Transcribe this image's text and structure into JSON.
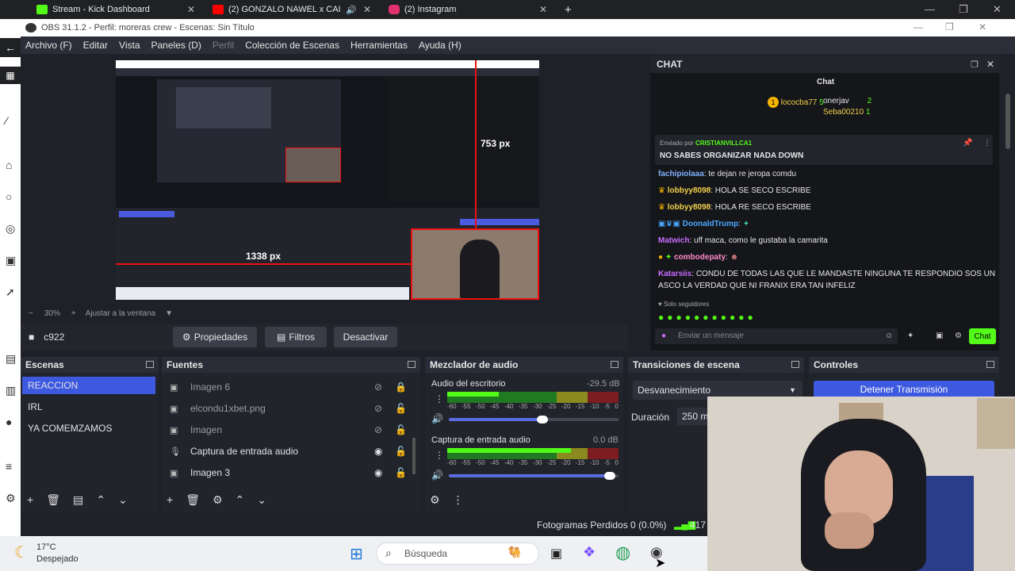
{
  "browser": {
    "tabs": [
      {
        "label": "Stream - Kick Dashboard",
        "color": "#53fc18"
      },
      {
        "label": "(2) GONZALO NAWEL x CAI",
        "color": "#ff0000"
      },
      {
        "label": "(2) Instagram",
        "color": "#e1306c"
      }
    ],
    "new_tab": "+"
  },
  "obs": {
    "title": "OBS 31.1.2 - Perfil: moreras crew - Escenas: Sin Título",
    "menu": [
      "Archivo (F)",
      "Editar",
      "Vista",
      "Paneles (D)",
      "Perfil",
      "Colección de Escenas",
      "Herramientas",
      "Ayuda (H)"
    ],
    "zoom": "30%",
    "zoom_fit": "Ajustar a la ventana",
    "source_name": "c922",
    "buttons": {
      "properties": "Propiedades",
      "filters": "Filtros",
      "deactivate": "Desactivar"
    },
    "preview": {
      "w_label": "1338 px",
      "h_label": "753 px"
    },
    "docks": {
      "scenes": "Escenas",
      "sources": "Fuentes",
      "mixer": "Mezclador de audio",
      "transitions": "Transiciones de escena",
      "controls": "Controles"
    },
    "scenes": [
      "REACCION",
      "IRL",
      "YA COMEMZAMOS"
    ],
    "sources": [
      {
        "name": "Imagen 6",
        "visible": false,
        "locked": true
      },
      {
        "name": "elcondu1xbet.png",
        "visible": false,
        "locked": false
      },
      {
        "name": "Imagen",
        "visible": false,
        "locked": false
      },
      {
        "name": "Captura de entrada audio",
        "visible": true,
        "locked": false
      },
      {
        "name": "Imagen 3",
        "visible": true,
        "locked": false
      }
    ],
    "mixer": [
      {
        "name": "Audio del escritorio",
        "db": "-29.5 dB",
        "level": 0.3,
        "volume": 0.55
      },
      {
        "name": "Captura de entrada audio",
        "db": "0.0 dB",
        "level": 0.72,
        "volume": 0.95
      }
    ],
    "meter_ticks": [
      "-60",
      "-55",
      "-50",
      "-45",
      "-40",
      "-35",
      "-30",
      "-25",
      "-20",
      "-15",
      "-10",
      "-5",
      "0"
    ],
    "transition": "Desvanecimiento",
    "duration_label": "Duración",
    "duration_value": "250 m",
    "stop_button": "Detener Transmisión",
    "dropped_frames": "Fotogramas Perdidos 0 (0.0%)",
    "bitrate": "417"
  },
  "chat": {
    "header": "CHAT",
    "subheader": "Chat",
    "top": [
      {
        "name": "lococba77",
        "count": "5"
      },
      {
        "name": "onerjav",
        "count": "2"
      },
      {
        "name": "Seba00210",
        "count": "1"
      }
    ],
    "pinned_by_label": "Enviado por",
    "pinned_user": "CRISTIANVILLCA1",
    "pinned_message": "NO SABES ORGANIZAR NADA DOWN",
    "messages": [
      {
        "user": "fachipiolaaa",
        "text": "te dejan re jeropa comdu",
        "color": "#7fb2ff"
      },
      {
        "user": "lobbyy8098",
        "text": "HOLA SE SECO ESCRIBE",
        "color": "#f2d04a"
      },
      {
        "user": "lobbyy8098",
        "text": "HOLA RE SECO ESCRIBE",
        "color": "#f2d04a"
      },
      {
        "user": "DoonaldTrump",
        "text": "",
        "color": "#4aa8ff"
      },
      {
        "user": "Matwich",
        "text": "uff maca, como le gustaba la camarita",
        "color": "#c96bff"
      },
      {
        "user": "combodepaty",
        "text": "",
        "color": "#ff8acb"
      },
      {
        "user": "Katarsiis",
        "text": "CONDU DE TODAS LAS QUE LE MANDASTE NINGUNA TE RESPONDIO SOS UN",
        "color": "#c96bff"
      }
    ],
    "message_cont": "ASCO LA VERDAD QUE NI FRANIX ERA TAN INFELIZ",
    "followers_only": "Solo seguidores",
    "input_placeholder": "Enviar un mensaje",
    "send": "Chat"
  },
  "taskbar": {
    "temp": "17°C",
    "weather": "Despejado",
    "search_placeholder": "Búsqueda"
  }
}
